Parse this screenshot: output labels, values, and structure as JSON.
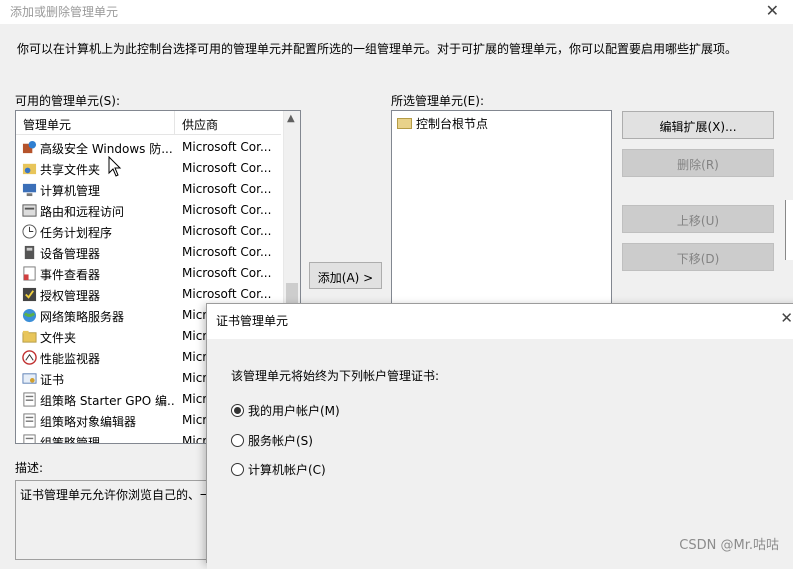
{
  "window": {
    "title": "添加或删除管理单元",
    "close_glyph": "✕",
    "intro": "你可以在计算机上为此控制台选择可用的管理单元并配置所选的一组管理单元。对于可扩展的管理单元，你可以配置要启用哪些扩展项。"
  },
  "available": {
    "label": "可用的管理单元(S):",
    "headers": {
      "name": "管理单元",
      "vendor": "供应商"
    },
    "rows": [
      {
        "name": "高级安全 Windows 防...",
        "vendor": "Microsoft Cor...",
        "icon": "firewall-icon"
      },
      {
        "name": "共享文件夹",
        "vendor": "Microsoft Cor...",
        "icon": "shared-folder-icon"
      },
      {
        "name": "计算机管理",
        "vendor": "Microsoft Cor...",
        "icon": "computer-management-icon"
      },
      {
        "name": "路由和远程访问",
        "vendor": "Microsoft Cor...",
        "icon": "routing-icon"
      },
      {
        "name": "任务计划程序",
        "vendor": "Microsoft Cor...",
        "icon": "clock-icon"
      },
      {
        "name": "设备管理器",
        "vendor": "Microsoft Cor...",
        "icon": "device-manager-icon"
      },
      {
        "name": "事件查看器",
        "vendor": "Microsoft Cor...",
        "icon": "event-viewer-icon"
      },
      {
        "name": "授权管理器",
        "vendor": "Microsoft Cor...",
        "icon": "authorization-icon"
      },
      {
        "name": "网络策略服务器",
        "vendor": "Micr",
        "icon": "globe-icon"
      },
      {
        "name": "文件夹",
        "vendor": "Micr",
        "icon": "folder-icon"
      },
      {
        "name": "性能监视器",
        "vendor": "Micr",
        "icon": "performance-icon"
      },
      {
        "name": "证书",
        "vendor": "Micr",
        "icon": "certificate-icon"
      },
      {
        "name": "组策略 Starter GPO 编...",
        "vendor": "Micr",
        "icon": "gpo-icon"
      },
      {
        "name": "组策略对象编辑器",
        "vendor": "Micr",
        "icon": "gpo-editor-icon"
      },
      {
        "name": "组策略管理",
        "vendor": "Micr",
        "icon": "gpo-manage-icon"
      }
    ]
  },
  "selected": {
    "label": "所选管理单元(E):",
    "root": "控制台根节点"
  },
  "buttons": {
    "add": "添加(A) >",
    "edit_ext": "编辑扩展(X)...",
    "remove": "删除(R)",
    "move_up": "上移(U)",
    "move_down": "下移(D)"
  },
  "description": {
    "label": "描述:",
    "text": "证书管理单元允许你浏览自己的、一"
  },
  "cert_dialog": {
    "title": "证书管理单元",
    "close_glyph": "✕",
    "prompt": "该管理单元将始终为下列帐户管理证书:",
    "options": [
      {
        "label": "我的用户帐户(M)",
        "checked": true
      },
      {
        "label": "服务帐户(S)",
        "checked": false
      },
      {
        "label": "计算机帐户(C)",
        "checked": false
      }
    ]
  },
  "watermark": "CSDN @Mr.咕咕"
}
